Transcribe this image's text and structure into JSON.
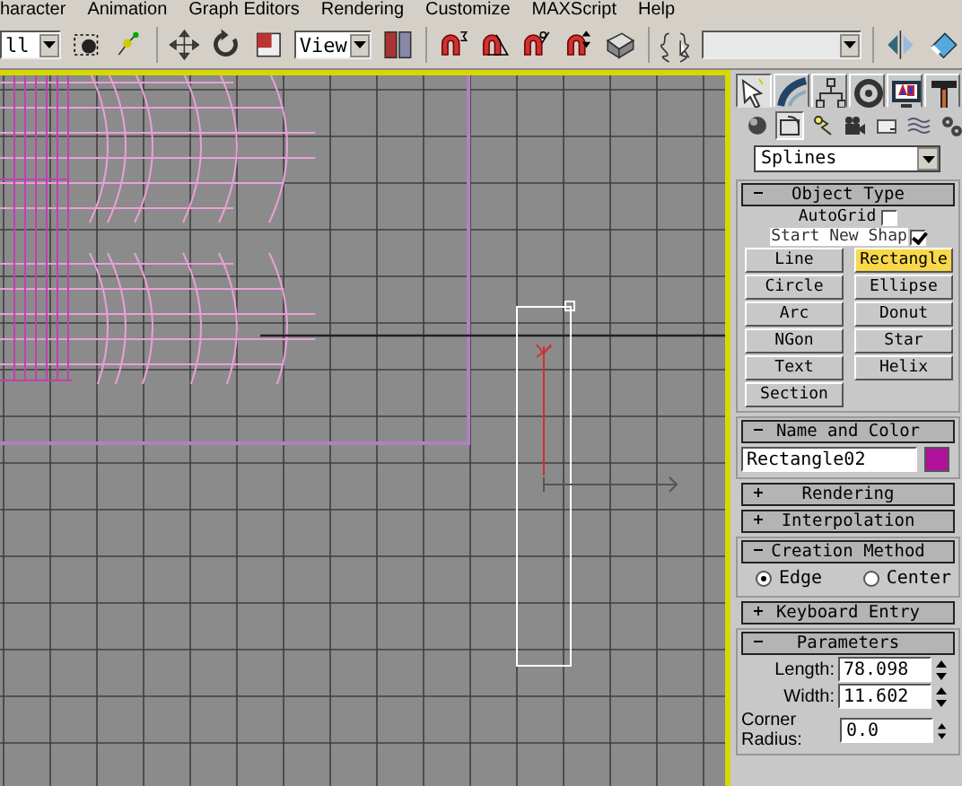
{
  "menu": [
    "haracter",
    "Animation",
    "Graph Editors",
    "Rendering",
    "Customize",
    "MAXScript",
    "Help"
  ],
  "toolbar": {
    "selection_filter": "ll",
    "reference_coord": "View"
  },
  "panel": {
    "tabs": [
      {
        "kind": "create",
        "selected": true
      },
      {
        "kind": "modify",
        "selected": false
      },
      {
        "kind": "hierarchy",
        "selected": false
      },
      {
        "kind": "motion",
        "selected": false
      },
      {
        "kind": "display",
        "selected": false
      },
      {
        "kind": "utilities",
        "selected": false
      }
    ],
    "categories": [
      {
        "kind": "geometry",
        "selected": false
      },
      {
        "kind": "shapes",
        "selected": true
      },
      {
        "kind": "lights",
        "selected": false
      },
      {
        "kind": "cameras",
        "selected": false
      },
      {
        "kind": "helpers",
        "selected": false
      },
      {
        "kind": "spacewarps",
        "selected": false
      },
      {
        "kind": "systems",
        "selected": false
      }
    ],
    "subcategory": "Splines",
    "rollouts": [
      {
        "kind": "object_type",
        "title": "Object Type",
        "expanded": true,
        "autogrid": {
          "label": "AutoGrid",
          "checked": false
        },
        "start_new_shape": {
          "label": "Start New Shap",
          "checked": true
        },
        "buttons": [
          {
            "label": "Line",
            "selected": false
          },
          {
            "label": "Rectangle",
            "selected": true
          },
          {
            "label": "Circle",
            "selected": false
          },
          {
            "label": "Ellipse",
            "selected": false
          },
          {
            "label": "Arc",
            "selected": false
          },
          {
            "label": "Donut",
            "selected": false
          },
          {
            "label": "NGon",
            "selected": false
          },
          {
            "label": "Star",
            "selected": false
          },
          {
            "label": "Text",
            "selected": false
          },
          {
            "label": "Helix",
            "selected": false
          },
          {
            "label": "Section",
            "selected": false
          }
        ]
      },
      {
        "kind": "name_color",
        "title": "Name and Color",
        "expanded": true,
        "name": "Rectangle02",
        "color": "#b0109c"
      },
      {
        "kind": "collapsed",
        "title": "Rendering",
        "expanded": false
      },
      {
        "kind": "collapsed",
        "title": "Interpolation",
        "expanded": false
      },
      {
        "kind": "creation_method",
        "title": "Creation Method",
        "expanded": true,
        "options": [
          {
            "label": "Edge",
            "selected": true
          },
          {
            "label": "Center",
            "selected": false
          }
        ]
      },
      {
        "kind": "collapsed",
        "title": "Keyboard Entry",
        "expanded": false
      },
      {
        "kind": "parameters",
        "title": "Parameters",
        "expanded": true,
        "fields": [
          {
            "label": "Length:",
            "value": "78.098"
          },
          {
            "label": "Width:",
            "value": "11.602"
          },
          {
            "label": "Corner Radius:",
            "value": "0.0"
          }
        ]
      }
    ]
  }
}
